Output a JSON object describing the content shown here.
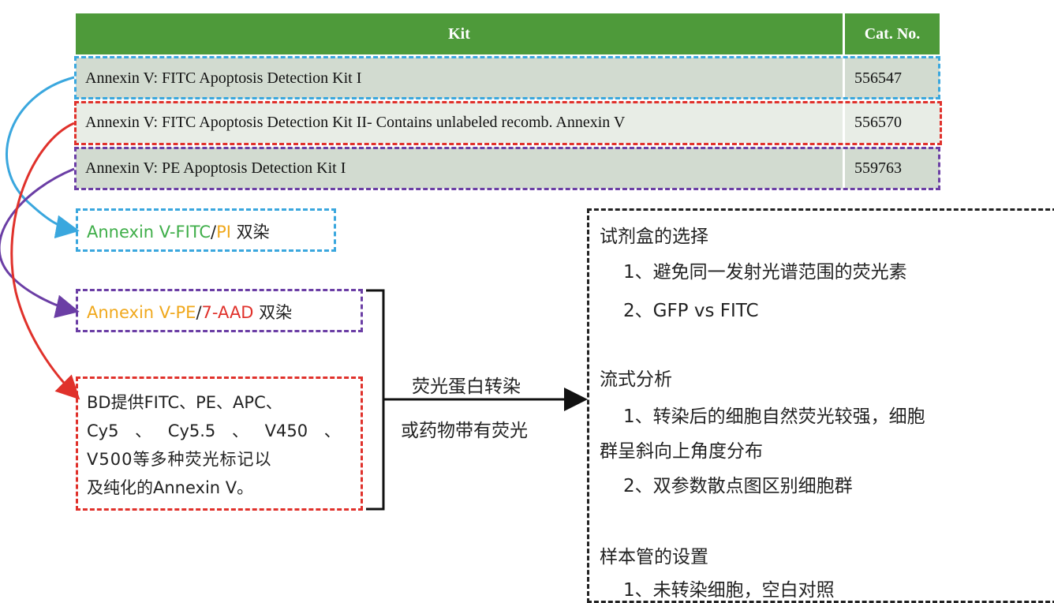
{
  "table": {
    "header": {
      "kit": "Kit",
      "cat": "Cat. No."
    },
    "rows": [
      {
        "kit": "Annexin V: FITC Apoptosis  Detection Kit I",
        "cat": "556547"
      },
      {
        "kit": "Annexin V: FITC Apoptosis  Detection Kit II- Contains unlabeled recomb. Annexin V",
        "cat": "556570"
      },
      {
        "kit": "Annexin V: PE Apoptosis  Detection Kit I",
        "cat": "559763"
      }
    ]
  },
  "box1": {
    "part1": "Annexin V-FITC",
    "sep": "/",
    "part2": "PI",
    "suffix": " 双染"
  },
  "box2": {
    "part1": "Annexin V-PE",
    "sep": "/",
    "part2": "7-AAD",
    "suffix": " 双染"
  },
  "box3": {
    "lines": [
      "BD提供FITC、PE、APC、",
      "Cy5 、 Cy5.5 、 V450 、",
      "V500等多种荧光标记以",
      "及纯化的Annexin V。"
    ]
  },
  "middle": {
    "line1": "荧光蛋白转染",
    "line2": "或药物带有荧光"
  },
  "right_panel": {
    "sec1_title": "试剂盒的选择",
    "sec1_items": [
      "1、避免同一发射光谱范围的荧光素",
      "2、GFP vs FITC"
    ],
    "sec2_title": "流式分析",
    "sec2_items": [
      "1、转染后的细胞自然荧光较强，细胞",
      "群呈斜向上角度分布",
      "2、双参数散点图区别细胞群"
    ],
    "sec3_title": "样本管的设置",
    "sec3_items": [
      "1、未转染细胞，空白对照"
    ]
  },
  "colors": {
    "header_green": "#4e9a3a",
    "blue": "#3aa7de",
    "red": "#e0312b",
    "purple": "#6b3ea5",
    "green_text": "#3fae49",
    "orange_text": "#f0a81c"
  }
}
